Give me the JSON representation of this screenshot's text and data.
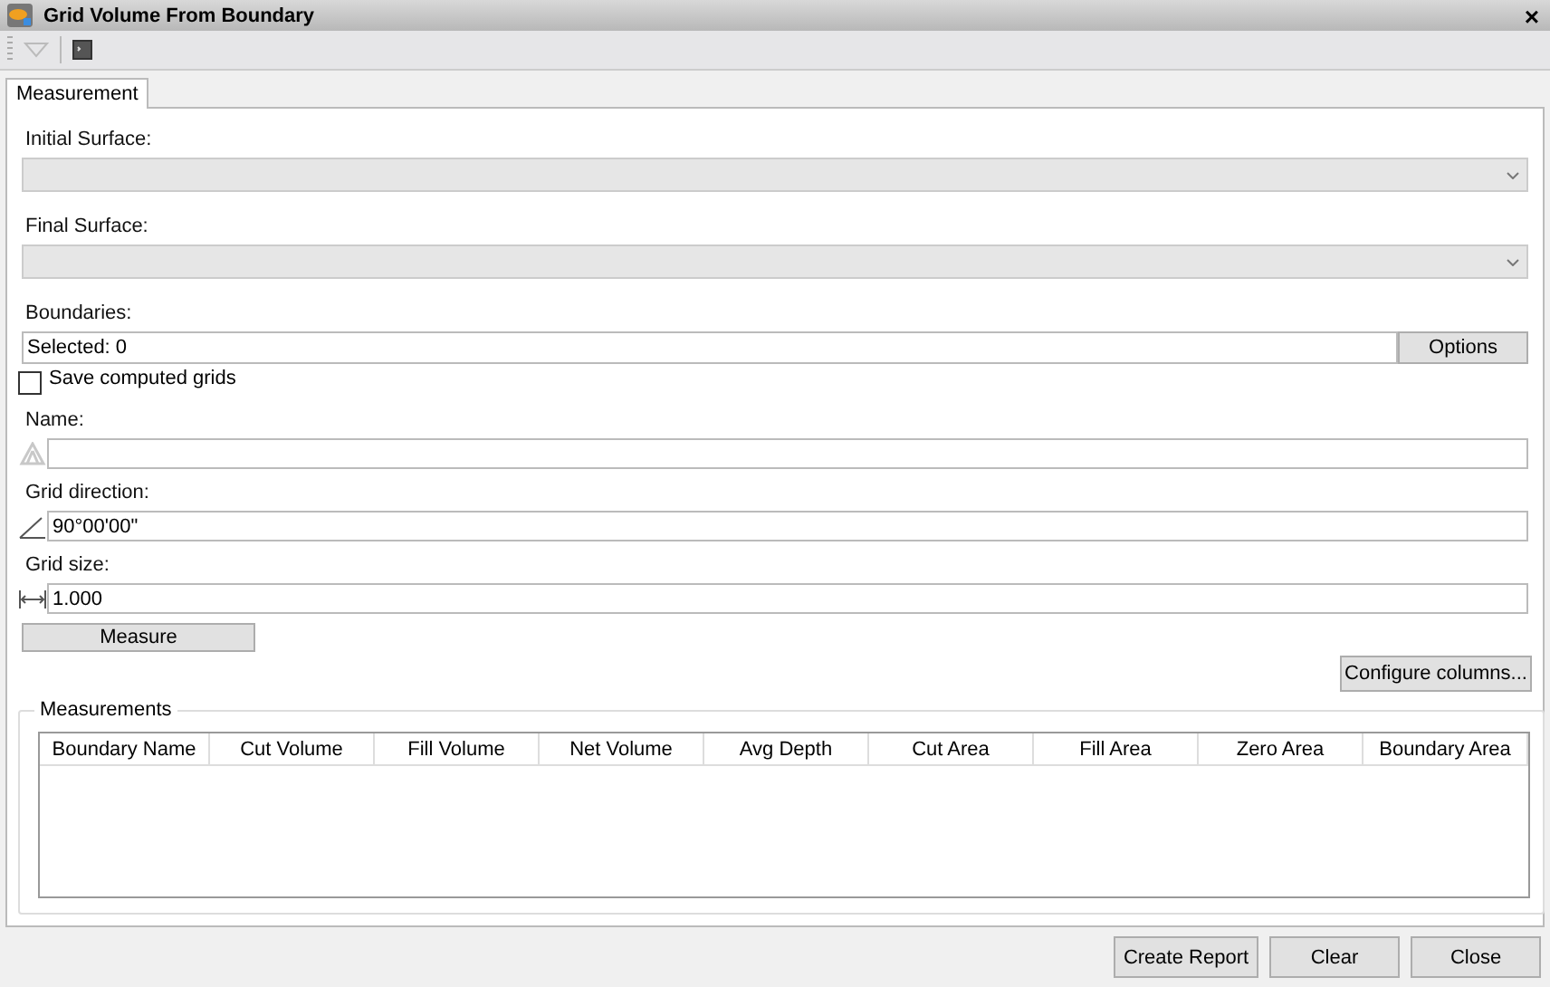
{
  "window": {
    "title": "Grid Volume From Boundary",
    "close": "×"
  },
  "tabs": [
    {
      "label": "Measurement",
      "selected": true
    }
  ],
  "fields": [
    {
      "kind": "combo",
      "label": "Initial Surface:",
      "disabled": true
    },
    {
      "kind": "combo",
      "label": "Final Surface:",
      "disabled": true
    },
    {
      "kind": "selection",
      "label": "Boundaries:",
      "value": "Selected: 0",
      "button": "Options"
    },
    {
      "kind": "checkbox",
      "label": "Save computed grids",
      "checked": false
    },
    {
      "kind": "icon_text",
      "label": "Name:"
    },
    {
      "kind": "icon_text",
      "label": "Grid direction:",
      "value": "90°00'00\""
    },
    {
      "kind": "icon_text",
      "label": "Grid size:",
      "value": "1.000"
    }
  ],
  "measure_button": "Measure",
  "configure_button": "Configure columns...",
  "measurements": {
    "title": "Measurements",
    "columns": [
      "Boundary Name",
      "Cut Volume",
      "Fill Volume",
      "Net Volume",
      "Avg Depth",
      "Cut Area",
      "Fill Area",
      "Zero Area",
      "Boundary Area"
    ]
  },
  "footer_buttons": [
    "Create Report",
    "Clear",
    "Close"
  ]
}
